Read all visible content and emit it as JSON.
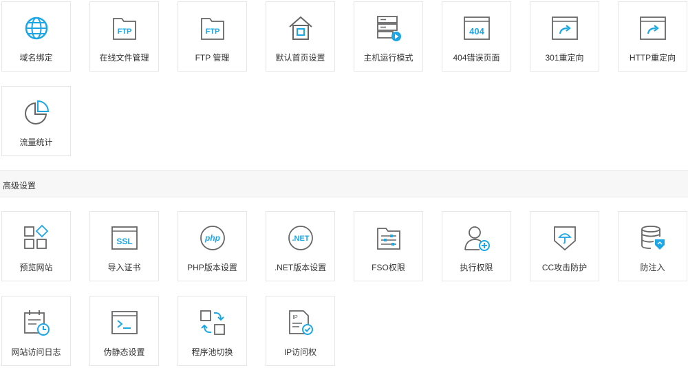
{
  "basic_tools": [
    {
      "label": "域名绑定",
      "icon": "globe-icon"
    },
    {
      "label": "在线文件管理",
      "icon": "ftp-folder-icon"
    },
    {
      "label": "FTP 管理",
      "icon": "ftp-folder-icon"
    },
    {
      "label": "默认首页设置",
      "icon": "home-icon"
    },
    {
      "label": "主机运行模式",
      "icon": "server-play-icon"
    },
    {
      "label": "404错误页面",
      "icon": "404-icon"
    },
    {
      "label": "301重定向",
      "icon": "redirect-icon"
    },
    {
      "label": "HTTP重定向",
      "icon": "redirect-icon"
    },
    {
      "label": "流量统计",
      "icon": "pie-chart-icon"
    }
  ],
  "advanced_section": {
    "title": "高级设置"
  },
  "advanced_tools": [
    {
      "label": "预览网站",
      "icon": "grid-icon"
    },
    {
      "label": "导入证书",
      "icon": "ssl-icon"
    },
    {
      "label": "PHP版本设置",
      "icon": "php-icon",
      "icon_text": "php"
    },
    {
      "label": ".NET版本设置",
      "icon": "dotnet-icon",
      "icon_text": ".NET"
    },
    {
      "label": "FSO权限",
      "icon": "folder-sliders-icon"
    },
    {
      "label": "执行权限",
      "icon": "user-add-icon"
    },
    {
      "label": "CC攻击防护",
      "icon": "shield-umbrella-icon"
    },
    {
      "label": "防注入",
      "icon": "database-shield-icon"
    },
    {
      "label": "网站访问日志",
      "icon": "calendar-clock-icon"
    },
    {
      "label": "伪静态设置",
      "icon": "terminal-icon"
    },
    {
      "label": "程序池切换",
      "icon": "swap-icon"
    },
    {
      "label": "IP访问权",
      "icon": "ip-doc-check-icon"
    }
  ],
  "icon_texts": {
    "ftp": "FTP",
    "ssl": "SSL",
    "e404": "404",
    "ip": "IP"
  },
  "colors": {
    "accent": "#1ba6e6",
    "icon_gray": "#666666",
    "text": "#333333"
  }
}
